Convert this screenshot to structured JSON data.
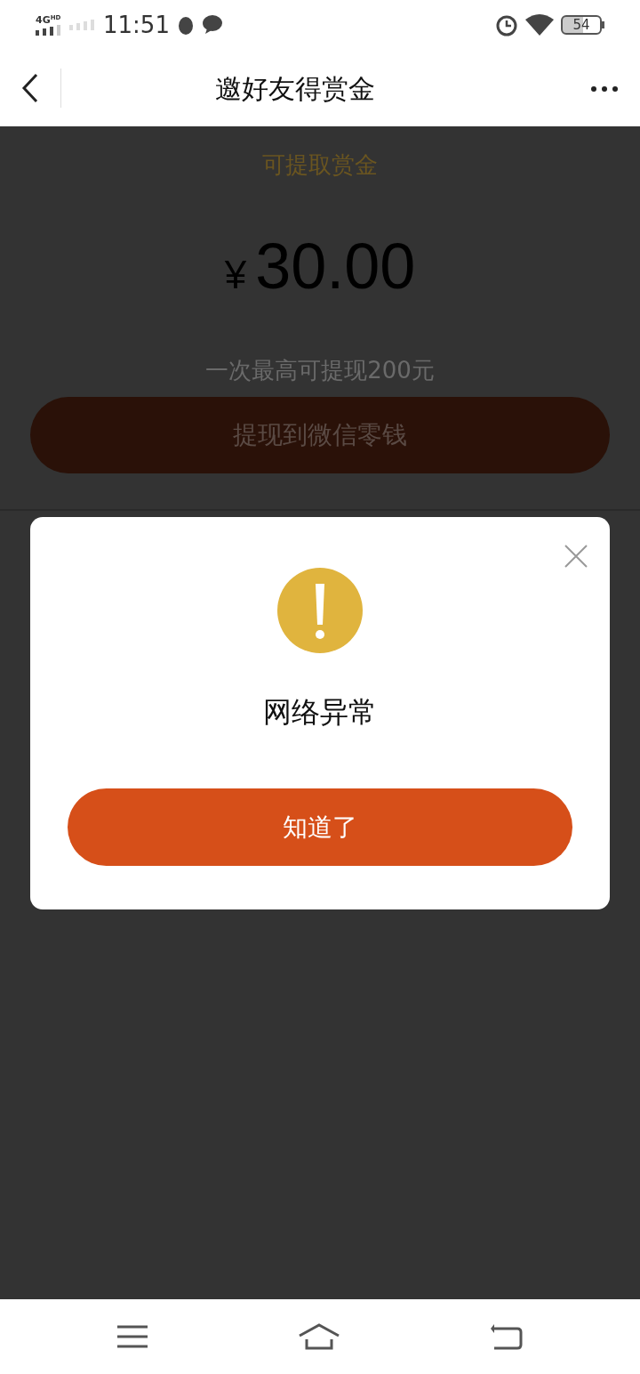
{
  "status_bar": {
    "network": "4G",
    "network_badge": "HD",
    "time": "11:51",
    "battery": "54"
  },
  "header": {
    "title": "邀好友得赏金"
  },
  "page": {
    "balance_label": "可提取赏金",
    "currency": "¥",
    "amount": "30.00",
    "limit_note": "一次最高可提现200元",
    "withdraw_button": "提现到微信零钱"
  },
  "dialog": {
    "message": "网络异常",
    "button": "知道了"
  }
}
